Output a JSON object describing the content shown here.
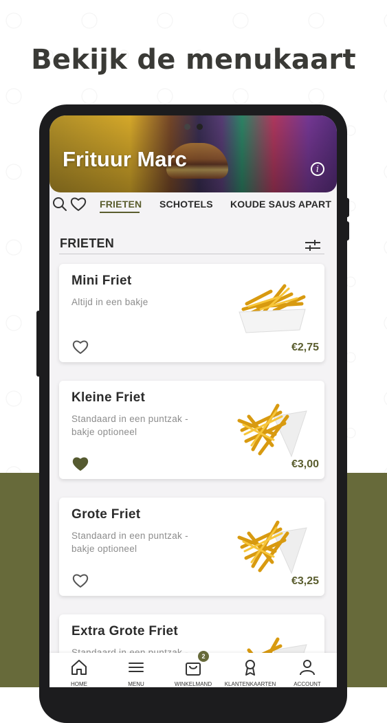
{
  "headline": "Bekijk de menukaart",
  "colors": {
    "brand_olive": "#676a3a",
    "accent_text": "#5a5d2e"
  },
  "restaurant": {
    "name": "Frituur Marc",
    "info_icon": "info-icon"
  },
  "tabs": [
    {
      "label": "FRIETEN",
      "active": true
    },
    {
      "label": "SCHOTELS",
      "active": false
    },
    {
      "label": "KOUDE SAUS APART",
      "active": false
    }
  ],
  "section": {
    "title": "FRIETEN"
  },
  "products": [
    {
      "name": "Mini Friet",
      "description": "Altijd in een bakje",
      "price": "€2,75",
      "favorite": false
    },
    {
      "name": "Kleine Friet",
      "description": "Standaard in een puntzak - bakje optioneel",
      "price": "€3,00",
      "favorite": true
    },
    {
      "name": "Grote Friet",
      "description": "Standaard in een puntzak - bakje optioneel",
      "price": "€3,25",
      "favorite": false
    },
    {
      "name": "Extra Grote Friet",
      "description": "Standaard in een puntzak -",
      "price": "",
      "favorite": false
    }
  ],
  "bottom_nav": [
    {
      "label": "HOME",
      "icon": "home-icon"
    },
    {
      "label": "MENU",
      "icon": "menu-icon"
    },
    {
      "label": "WINKELMAND",
      "icon": "cart-icon",
      "badge": "2"
    },
    {
      "label": "KLANTENKAARTEN",
      "icon": "loyalty-card-icon"
    },
    {
      "label": "ACCOUNT",
      "icon": "account-icon"
    }
  ]
}
